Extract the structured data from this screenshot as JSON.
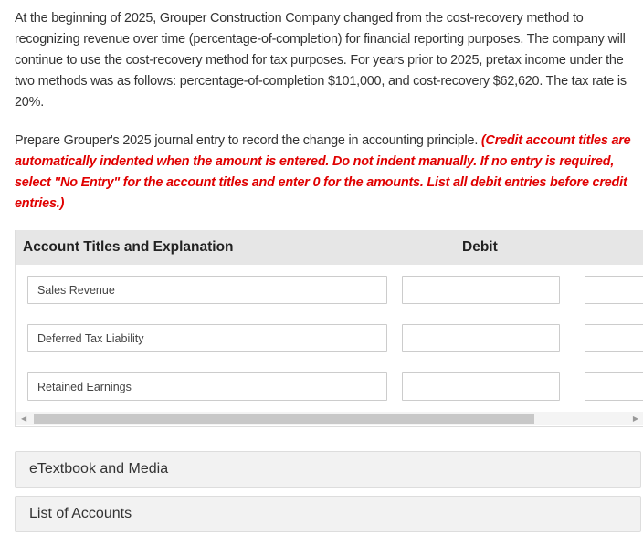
{
  "question": {
    "paragraph": "At the beginning of 2025, Grouper Construction Company changed from the cost-recovery method to recognizing revenue over time (percentage-of-completion) for financial reporting purposes. The company will continue to use the cost-recovery method for tax purposes. For years prior to 2025, pretax income under the two methods was as follows: percentage-of-completion $101,000, and cost-recovery $62,620. The tax rate is 20%.",
    "instruction": "Prepare Grouper's 2025 journal entry to record the change in accounting principle. ",
    "instruction_red": "(Credit account titles are automatically indented when the amount is entered. Do not indent manually. If no entry is required, select \"No Entry\" for the account titles and enter 0 for the amounts. List all debit entries before credit entries.)"
  },
  "table": {
    "headers": {
      "account": "Account Titles and Explanation",
      "debit": "Debit"
    },
    "rows": [
      {
        "account": "Sales Revenue",
        "debit": "",
        "credit": ""
      },
      {
        "account": "Deferred Tax Liability",
        "debit": "",
        "credit": ""
      },
      {
        "account": "Retained Earnings",
        "debit": "",
        "credit": ""
      }
    ]
  },
  "links": {
    "etextbook": "eTextbook and Media",
    "accounts": "List of Accounts"
  }
}
